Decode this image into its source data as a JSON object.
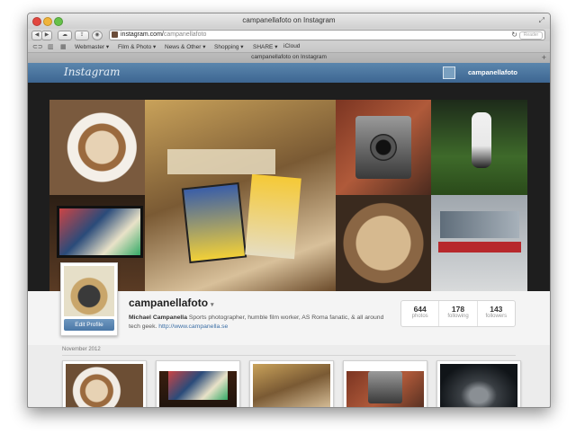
{
  "window": {
    "title": "campanellafoto on Instagram"
  },
  "toolbar": {
    "back_label": "◀",
    "forward_label": "▶",
    "url_host": "instagram.com/",
    "url_path": "campanellafoto",
    "reload_glyph": "↻",
    "reader_label": "Reader"
  },
  "bookmarks": {
    "items": [
      {
        "label": "Webmaster ▾"
      },
      {
        "label": "Film & Photo ▾"
      },
      {
        "label": "News & Other ▾"
      },
      {
        "label": "Shopping ▾"
      },
      {
        "label": "SHARE ▾"
      },
      {
        "label": "iCloud"
      }
    ]
  },
  "tab": {
    "title": "campanellafoto on Instagram",
    "new_tab": "+"
  },
  "instagram": {
    "logo": "Instagram",
    "header_username": "campanellafoto"
  },
  "profile": {
    "username": "campanellafoto",
    "caret": "▾",
    "full_name": "Michael Campanella",
    "bio": " Sports photographer, humble film worker, AS Roma fanatic, & all around tech geek. ",
    "website": "http://www.campanella.se",
    "edit_label": "Edit Profile",
    "stats": [
      {
        "num": "644",
        "label": "photos"
      },
      {
        "num": "178",
        "label": "following"
      },
      {
        "num": "143",
        "label": "followers"
      }
    ]
  },
  "feed": {
    "month": "November 2012"
  },
  "colors": {
    "ig_blue": "#3d6692",
    "link": "#3b6ea5"
  }
}
